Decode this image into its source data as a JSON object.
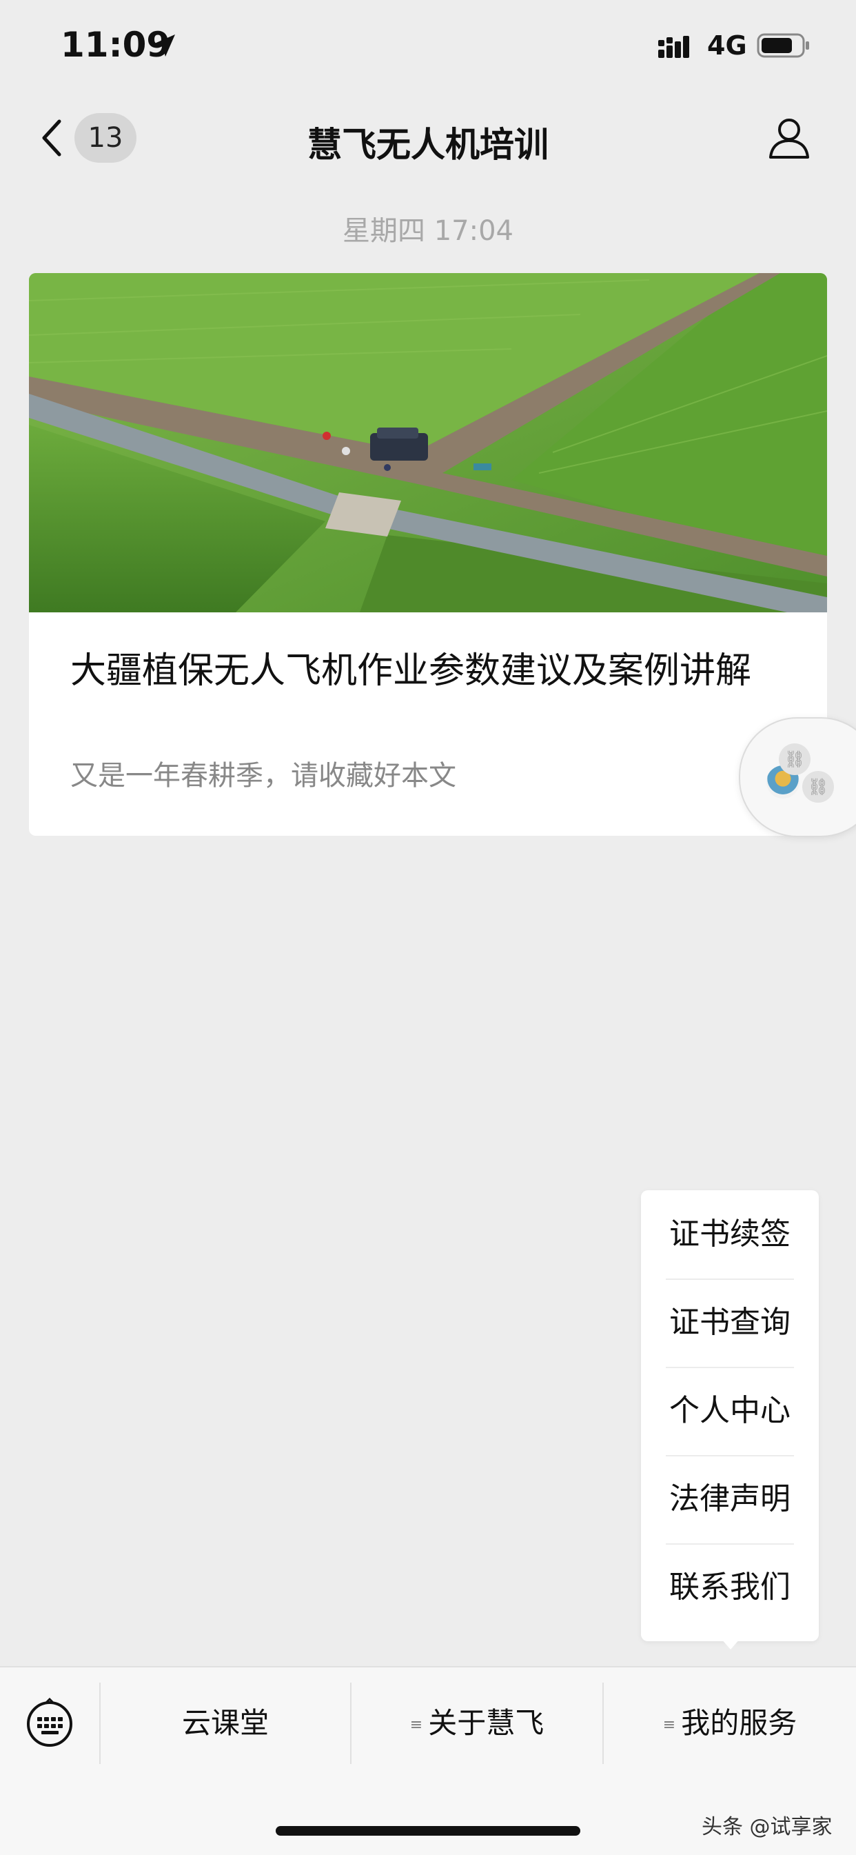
{
  "status_bar": {
    "time": "11:09",
    "network": "4G",
    "icons": [
      "location-arrow-icon",
      "signal-icon",
      "battery-icon"
    ]
  },
  "nav": {
    "unread_count": "13",
    "title": "慧飞无人机培训",
    "icons": [
      "back-chevron-icon",
      "profile-icon"
    ]
  },
  "timestamp": "星期四 17:04",
  "article": {
    "title": "大疆植保无人飞机作业参数建议及案例讲解",
    "subtitle": "又是一年春耕季，请收藏好本文",
    "image": "aerial-rice-field-photo"
  },
  "popup_menu": {
    "items": [
      "证书续签",
      "证书查询",
      "个人中心",
      "法律声明",
      "联系我们"
    ]
  },
  "bottom_menu": {
    "items": [
      {
        "label": "云课堂",
        "has_submenu": false
      },
      {
        "label": "关于慧飞",
        "has_submenu": true
      },
      {
        "label": "我的服务",
        "has_submenu": true
      }
    ],
    "submenu_marker": "≡"
  },
  "watermark": "头条 @试享家",
  "colors": {
    "background": "#ededed",
    "card": "#ffffff",
    "muted_text": "#a8a8a8",
    "field_green": "#6aa83a"
  }
}
